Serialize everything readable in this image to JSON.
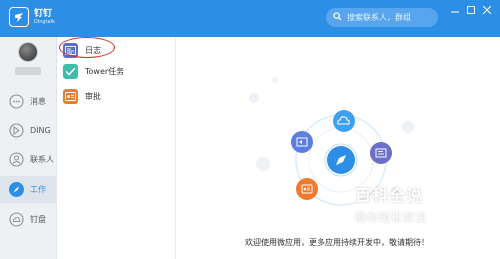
{
  "app": {
    "logo_cn": "钉钉",
    "logo_en": "Dingtalk"
  },
  "search": {
    "placeholder": "搜索联系人，群组"
  },
  "sidebar": {
    "items": [
      {
        "label": "消息",
        "icon": "chat-icon"
      },
      {
        "label": "DING",
        "icon": "ding-icon"
      },
      {
        "label": "联系人",
        "icon": "contacts-icon"
      },
      {
        "label": "工作",
        "icon": "work-icon"
      },
      {
        "label": "钉盘",
        "icon": "cloud-disk-icon"
      }
    ],
    "active": "工作"
  },
  "applist": {
    "items": [
      {
        "label": "日志",
        "icon": "log-icon",
        "color": "#5b6fc7"
      },
      {
        "label": "Tower任务",
        "icon": "check-icon",
        "color": "#3dbcab"
      },
      {
        "label": "审批",
        "icon": "approval-icon",
        "color": "#f07a2e"
      }
    ]
  },
  "main": {
    "welcome": "欢迎使用微应用，更多应用持续开发中，敬请期待！"
  },
  "watermark": {
    "title": "百科全说",
    "subtitle": "助你轻松解决"
  },
  "colors": {
    "brand": "#2d8ee6",
    "annotation": "#e0242a"
  }
}
